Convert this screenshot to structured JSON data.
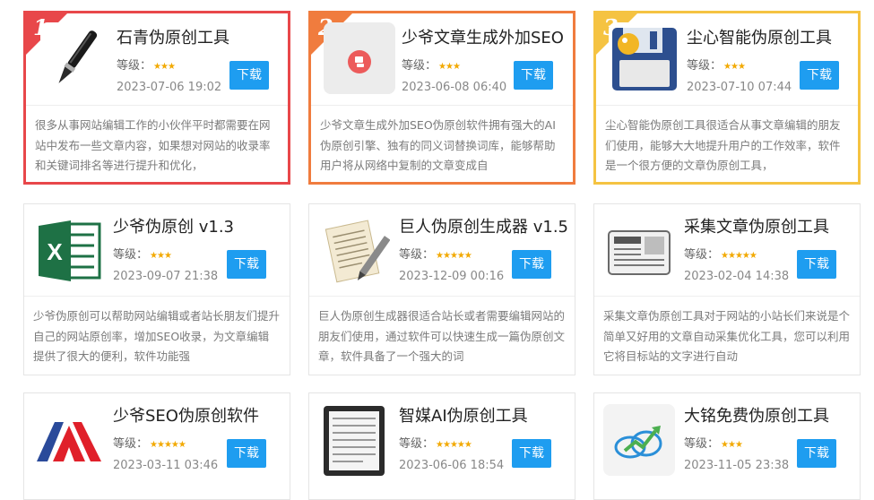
{
  "grade_label": "等级：",
  "download_label": "下载",
  "cards": [
    {
      "rank": "1",
      "title": "石青伪原创工具",
      "stars": "★★★",
      "date": "2023-07-06 19:02",
      "desc": "很多从事网站编辑工作的小伙伴平时都需要在网站中发布一些文章内容，如果想对网站的收录率和关键词排名等进行提升和优化，",
      "icon": "pen-icon",
      "accent": "#e8474a"
    },
    {
      "rank": "2",
      "title": "少爷文章生成外加SEO",
      "stars": "★★★",
      "date": "2023-06-08 06:40",
      "desc": "少爷文章生成外加SEO伪原创软件拥有强大的AI伪原创引擎、独有的同义词替换词库，能够帮助用户将从网络中复制的文章变成自",
      "icon": "app-logo-icon",
      "accent": "#f07c3e"
    },
    {
      "rank": "3",
      "title": "尘心智能伪原创工具",
      "stars": "★★★",
      "date": "2023-07-10 07:44",
      "desc": "尘心智能伪原创工具很适合从事文章编辑的朋友们使用，能够大大地提升用户的工作效率，软件是一个很方便的文章伪原创工具，",
      "icon": "floppy-disk-icon",
      "accent": "#f5c342"
    },
    {
      "rank": "",
      "title": "少爷伪原创 v1.3",
      "stars": "★★★",
      "date": "2023-09-07 21:38",
      "desc": "少爷伪原创可以帮助网站编辑或者站长朋友们提升自己的网站原创率，增加SEO收录，为文章编辑提供了很大的便利，软件功能强",
      "icon": "excel-icon"
    },
    {
      "rank": "",
      "title": "巨人伪原创生成器 v1.5",
      "stars": "★★★★★",
      "date": "2023-12-09 00:16",
      "desc": "巨人伪原创生成器很适合站长或者需要编辑网站的朋友们使用，通过软件可以快速生成一篇伪原创文章，软件具备了一个强大的词",
      "icon": "document-pen-icon"
    },
    {
      "rank": "",
      "title": "采集文章伪原创工具",
      "stars": "★★★★★",
      "date": "2023-02-04 14:38",
      "desc": "采集文章伪原创工具对于网站的小站长们来说是个简单又好用的文章自动采集优化工具，您可以利用它将目标站的文字进行自动",
      "icon": "newspaper-icon"
    },
    {
      "rank": "",
      "title": "少爷SEO伪原创软件",
      "stars": "★★★★★",
      "date": "2023-03-11 03:46",
      "desc": "",
      "icon": "red-logo-icon"
    },
    {
      "rank": "",
      "title": "智媒AI伪原创工具",
      "stars": "★★★★★",
      "date": "2023-06-06 18:54",
      "desc": "",
      "icon": "tablet-icon"
    },
    {
      "rank": "",
      "title": "大铭免费伪原创工具",
      "stars": "★★★",
      "date": "2023-11-05 23:38",
      "desc": "",
      "icon": "cloud-chart-icon"
    }
  ]
}
